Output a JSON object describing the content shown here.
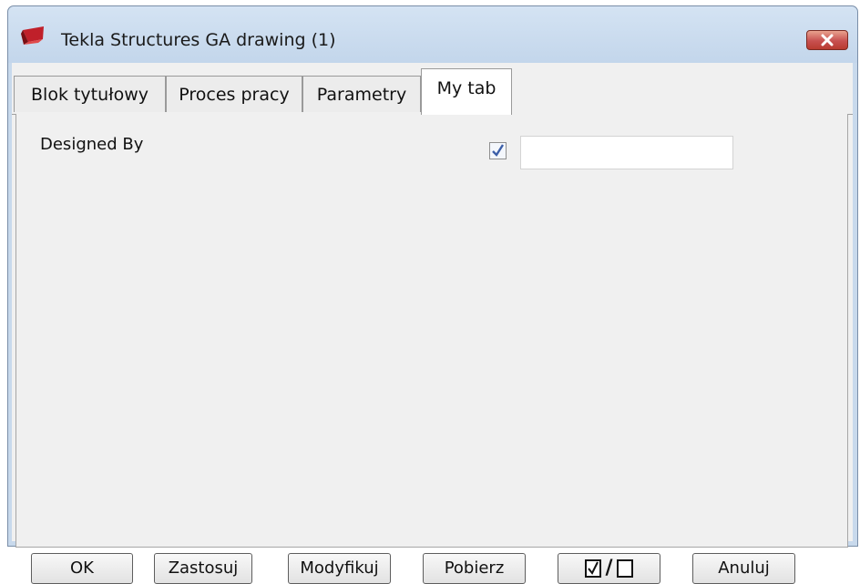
{
  "window": {
    "title": "Tekla Structures  GA drawing (1)",
    "app_icon": "tekla-logo-icon",
    "close_icon": "close-icon"
  },
  "tabs": [
    {
      "label": "Blok tytułowy",
      "active": false
    },
    {
      "label": "Proces pracy",
      "active": false
    },
    {
      "label": "Parametry",
      "active": false
    },
    {
      "label": "My tab",
      "active": true
    }
  ],
  "form": {
    "designed_by_label": "Designed By",
    "designed_by_checked": true,
    "designed_by_value": ""
  },
  "buttons": {
    "ok": "OK",
    "apply": "Zastosuj",
    "modify": "Modyfikuj",
    "get": "Pobierz",
    "toggle_slash": "/",
    "cancel": "Anuluj"
  },
  "colors": {
    "close_button": "#c75050",
    "window_frame": "#c8d9ec",
    "app_icon": "#c0202a"
  }
}
